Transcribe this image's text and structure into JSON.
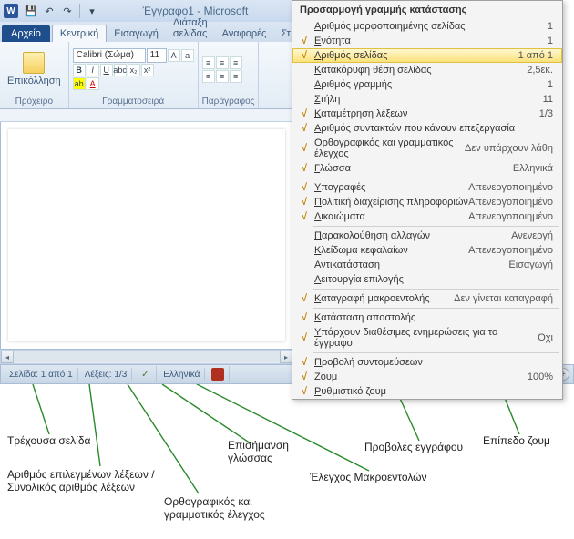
{
  "title": "Έγγραφο1 - Microsoft",
  "tabs": {
    "file": "Αρχείο",
    "home": "Κεντρική",
    "insert": "Εισαγωγή",
    "layout": "Διάταξη σελίδας",
    "refs": "Αναφορές",
    "mail": "Στ"
  },
  "ribbon": {
    "paste": "Επικόλληση",
    "clipboard": "Πρόχειρο",
    "fontname": "Calibri (Σώμα)",
    "fontsize": "11",
    "fontgroup": "Γραμματοσειρά",
    "paragroup": "Παράγραφος"
  },
  "status": {
    "page": "Σελίδα: 1 από 1",
    "words": "Λέξεις: 1/3",
    "lang": "Ελληνικά",
    "zoom": "100%"
  },
  "ctx": {
    "title": "Προσαρμογή γραμμής κατάστασης",
    "items": [
      {
        "c": false,
        "l": "Αριθμός μορφοποιημένης σελίδας",
        "v": "1"
      },
      {
        "c": true,
        "l": "Ενότητα",
        "v": "1"
      },
      {
        "c": true,
        "l": "Αριθμός σελίδας",
        "v": "1 από 1",
        "hl": true
      },
      {
        "c": false,
        "l": "Κατακόρυφη θέση σελίδας",
        "v": "2,5εκ."
      },
      {
        "c": false,
        "l": "Αριθμός γραμμής",
        "v": "1"
      },
      {
        "c": false,
        "l": "Στήλη",
        "v": "11"
      },
      {
        "c": true,
        "l": "Καταμέτρηση λέξεων",
        "v": "1/3"
      },
      {
        "c": true,
        "l": "Αριθμός συντακτών που κάνουν επεξεργασία",
        "v": ""
      },
      {
        "c": true,
        "l": "Ορθογραφικός και γραμματικός έλεγχος",
        "v": "Δεν υπάρχουν λάθη"
      },
      {
        "c": true,
        "l": "Γλώσσα",
        "v": "Ελληνικά"
      },
      {
        "c": true,
        "l": "Υπογραφές",
        "v": "Απενεργοποιημένο"
      },
      {
        "c": true,
        "l": "Πολιτική διαχείρισης πληροφοριών",
        "v": "Απενεργοποιημένο"
      },
      {
        "c": true,
        "l": "Δικαιώματα",
        "v": "Απενεργοποιημένο"
      },
      {
        "c": false,
        "l": "Παρακολούθηση αλλαγών",
        "v": "Ανενεργή"
      },
      {
        "c": false,
        "l": "Κλείδωμα κεφαλαίων",
        "v": "Απενεργοποιημένο"
      },
      {
        "c": false,
        "l": "Αντικατάσταση",
        "v": "Εισαγωγή"
      },
      {
        "c": false,
        "l": "Λειτουργία επιλογής",
        "v": ""
      },
      {
        "c": true,
        "l": "Καταγραφή μακροεντολής",
        "v": "Δεν γίνεται καταγραφή"
      },
      {
        "c": true,
        "l": "Κατάσταση αποστολής",
        "v": ""
      },
      {
        "c": true,
        "l": "Υπάρχουν διαθέσιμες ενημερώσεις για το έγγραφο",
        "v": "Όχι"
      },
      {
        "c": true,
        "l": "Προβολή συντομεύσεων",
        "v": ""
      },
      {
        "c": true,
        "l": "Ζουμ",
        "v": "100%"
      },
      {
        "c": true,
        "l": "Ρυθμιστικό ζουμ",
        "v": ""
      }
    ]
  },
  "callouts": {
    "page": "Τρέχουσα σελίδα",
    "words": "Αριθμός επιλεγμένων λέξεων / Συνολικός αριθμός λέξεων",
    "spell": "Ορθογραφικός και γραμματικός έλεγχος",
    "lang": "Επισήμανση γλώσσας",
    "macro": "Έλεγχος Μακροεντολών",
    "views": "Προβολές εγγράφου",
    "zoom": "Επίπεδο ζουμ"
  }
}
